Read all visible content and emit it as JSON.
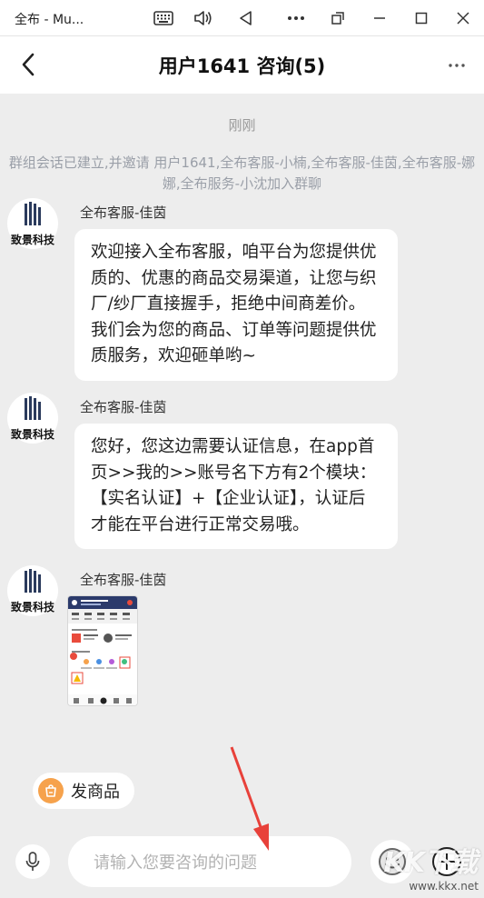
{
  "window": {
    "title": "全布 - Mu..."
  },
  "header": {
    "title": "用户1641 咨询(5)"
  },
  "chat": {
    "timestamp": "刚刚",
    "system_message": "群组会话已建立,并邀请 用户1641,全布客服-小楠,全布客服-佳茵,全布客服-娜娜,全布服务-小沈加入群聊",
    "messages": [
      {
        "sender": "全布客服-佳茵",
        "avatar_text": "致景科技",
        "text": "欢迎接入全布客服，咱平台为您提供优质的、优惠的商品交易渠道，让您与织厂/纱厂直接握手，拒绝中间商差价。我们会为您的商品、订单等问题提供优质服务，欢迎砸单哟~"
      },
      {
        "sender": "全布客服-佳茵",
        "avatar_text": "致景科技",
        "text": "您好，您这边需要认证信息，在app首页>>我的>>账号名下方有2个模块：【实名认证】+【企业认证】，认证后才能在平台进行正常交易哦。"
      },
      {
        "sender": "全布客服-佳茵",
        "avatar_text": "致景科技",
        "type": "image"
      }
    ]
  },
  "quick_action": {
    "label": "发商品",
    "icon": "shopping-bag-icon"
  },
  "input": {
    "placeholder": "请输入您要咨询的问题"
  },
  "watermark": {
    "logo_text": "KK下载",
    "url": "www.kkx.net"
  },
  "colors": {
    "background": "#ededed",
    "bubble": "#ffffff",
    "chip_icon": "#f6a24c",
    "annotation_arrow": "#e8413a"
  }
}
